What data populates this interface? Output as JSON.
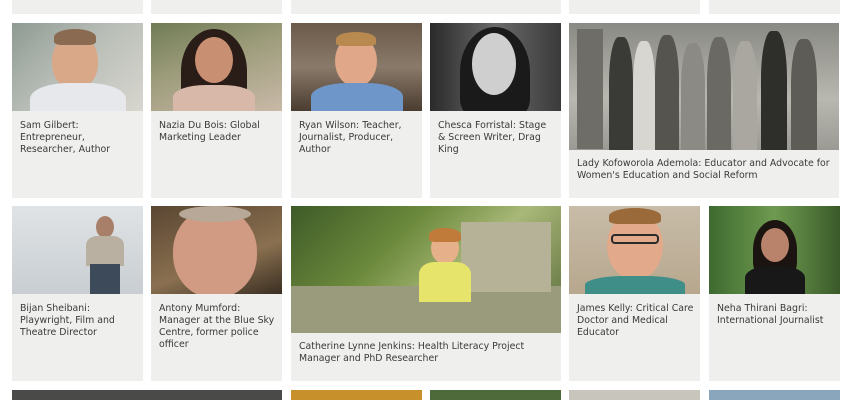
{
  "profiles": [
    {
      "caption": "Sam Gilbert: Entrepreneur, Researcher, Author",
      "photo": "photo-portrait"
    },
    {
      "caption": "Nazia Du Bois: Global Marketing Leader",
      "photo": "photo-portrait"
    },
    {
      "caption": "Ryan Wilson: Teacher, Journalist, Producer, Author",
      "photo": "photo-portrait"
    },
    {
      "caption": "Chesca Forristal: Stage & Screen Writer, Drag King",
      "photo": "photo-portrait-bw"
    },
    {
      "caption": "Lady Kofoworola Ademola: Educator and Advocate for Women's Education and Social Reform",
      "photo": "photo-group-bw"
    },
    {
      "caption": "Bijan Sheibani: Playwright, Film and Theatre Director",
      "photo": "photo-portrait"
    },
    {
      "caption": "Antony Mumford: Manager at the Blue Sky Centre, former police officer",
      "photo": "photo-portrait"
    },
    {
      "caption": "Catherine Lynne Jenkins: Health Literacy Project Manager and PhD Researcher",
      "photo": "photo-garden"
    },
    {
      "caption": "James Kelly: Critical Care Doctor and Medical Educator",
      "photo": "photo-portrait"
    },
    {
      "caption": "Neha Thirani Bagri: International Journalist",
      "photo": "photo-portrait"
    }
  ]
}
